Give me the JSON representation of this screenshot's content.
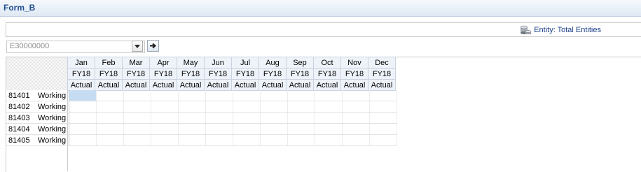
{
  "form": {
    "title": "Form_B"
  },
  "pov": {
    "entity_label": "Entity: Total Entities",
    "entity_icon": "cylinder-database-icon"
  },
  "member_selector": {
    "value": "E30000000",
    "go_icon": "arrow-right-icon"
  },
  "grid": {
    "columns": [
      {
        "month": "Jan",
        "year": "FY18",
        "scenario": "Actual"
      },
      {
        "month": "Feb",
        "year": "FY18",
        "scenario": "Actual"
      },
      {
        "month": "Mar",
        "year": "FY18",
        "scenario": "Actual"
      },
      {
        "month": "Apr",
        "year": "FY18",
        "scenario": "Actual"
      },
      {
        "month": "May",
        "year": "FY18",
        "scenario": "Actual"
      },
      {
        "month": "Jun",
        "year": "FY18",
        "scenario": "Actual"
      },
      {
        "month": "Jul",
        "year": "FY18",
        "scenario": "Actual"
      },
      {
        "month": "Aug",
        "year": "FY18",
        "scenario": "Actual"
      },
      {
        "month": "Sep",
        "year": "FY18",
        "scenario": "Actual"
      },
      {
        "month": "Oct",
        "year": "FY18",
        "scenario": "Actual"
      },
      {
        "month": "Nov",
        "year": "FY18",
        "scenario": "Actual"
      },
      {
        "month": "Dec",
        "year": "FY18",
        "scenario": "Actual"
      }
    ],
    "rows": [
      {
        "code": "81401",
        "version": "Working"
      },
      {
        "code": "81402",
        "version": "Working"
      },
      {
        "code": "81403",
        "version": "Working"
      },
      {
        "code": "81404",
        "version": "Working"
      },
      {
        "code": "81405",
        "version": "Working"
      }
    ]
  }
}
